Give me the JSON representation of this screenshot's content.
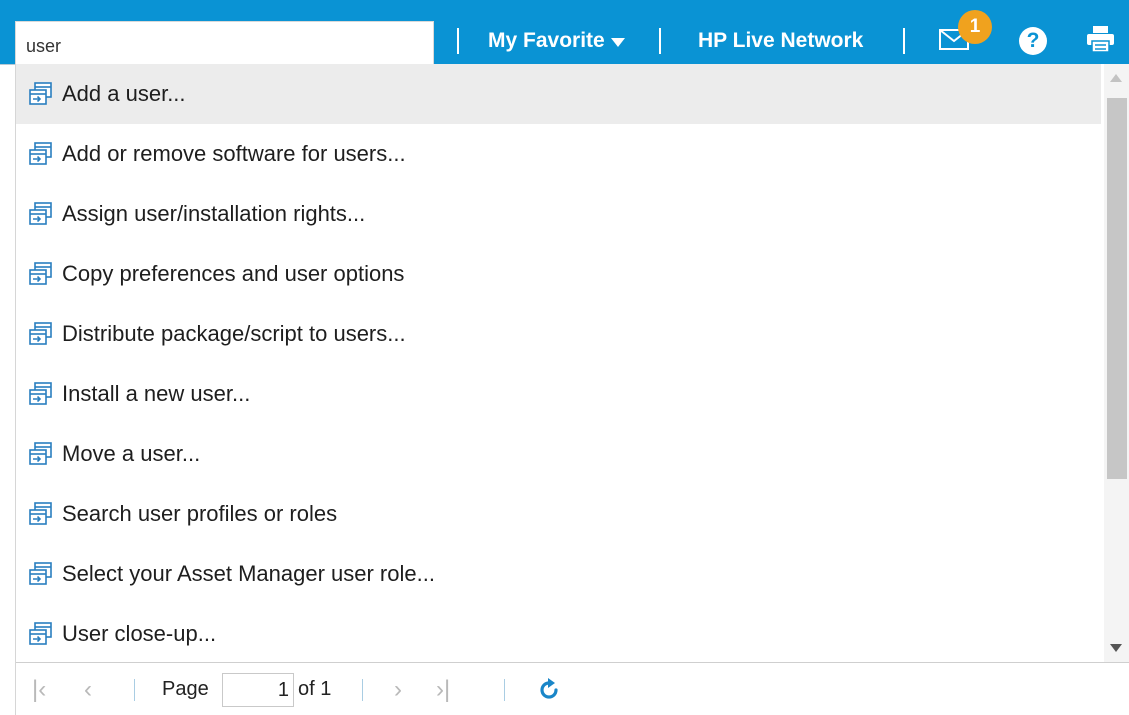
{
  "search": {
    "value": "user"
  },
  "header": {
    "favorite_label": "My Favorite",
    "live_network_label": "HP Live Network",
    "notification_count": "1",
    "help_glyph": "?",
    "accent_color": "#0a93d4",
    "badge_color": "#f0a21e"
  },
  "results": {
    "items": [
      {
        "label": "Add a user...",
        "icon": "open-window-icon"
      },
      {
        "label": "Add or remove software for users...",
        "icon": "open-window-icon"
      },
      {
        "label": "Assign user/installation rights...",
        "icon": "open-window-icon"
      },
      {
        "label": "Copy preferences and user options",
        "icon": "open-window-icon"
      },
      {
        "label": "Distribute package/script to users...",
        "icon": "open-window-icon"
      },
      {
        "label": "Install a new user...",
        "icon": "open-window-icon"
      },
      {
        "label": "Move a user...",
        "icon": "open-window-icon"
      },
      {
        "label": "Search user profiles or roles",
        "icon": "open-window-icon"
      },
      {
        "label": "Select your Asset Manager user role...",
        "icon": "open-window-icon"
      },
      {
        "label": "User close-up...",
        "icon": "open-window-icon"
      }
    ],
    "highlighted_index": 0
  },
  "pager": {
    "page_label": "Page",
    "current_page": "1",
    "of_label": "of 1"
  }
}
